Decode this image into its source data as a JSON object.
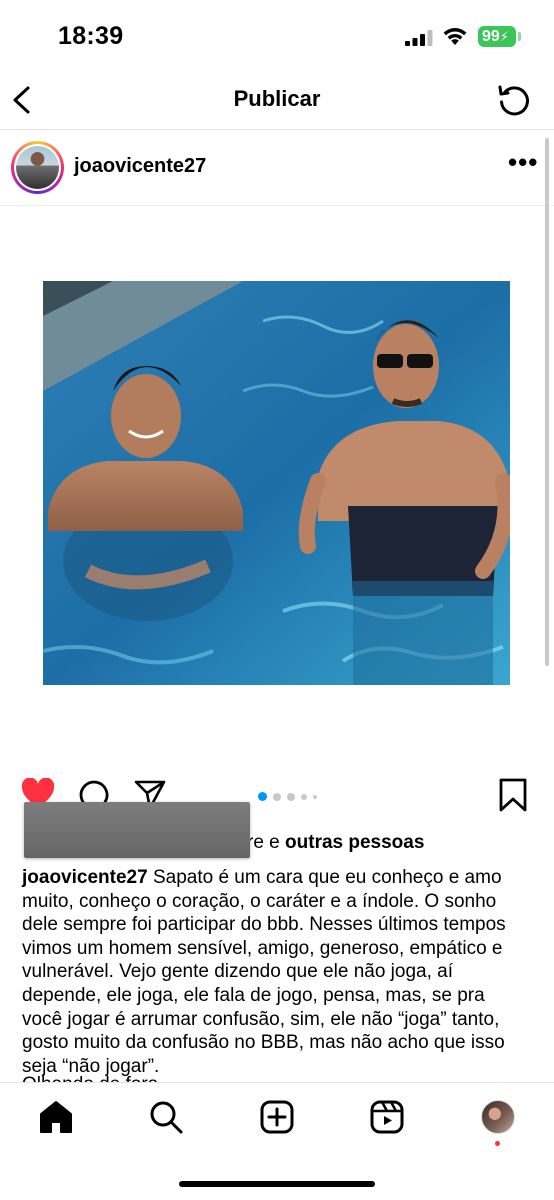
{
  "status_bar": {
    "time": "18:39",
    "battery": "99",
    "icons": [
      "cellular-signal-icon",
      "wifi-icon",
      "battery-charging-icon"
    ],
    "battery_color": "#3cc65a"
  },
  "header": {
    "title": "Publicar",
    "back_icon": "chevron-left-icon",
    "refresh_icon": "refresh-icon"
  },
  "post": {
    "username": "joaovicente27",
    "more_icon": "more-horizontal-icon",
    "photo_description_icon": "post-image",
    "carousel": {
      "total": 5,
      "current": 1,
      "active_color": "#0095f6"
    },
    "liked": true,
    "like_color": "#ff3040",
    "likes": {
      "visible_fragment": "re e ",
      "others_bold": "outras pessoas"
    },
    "caption": {
      "author": "joaovicente27",
      "text": "Sapato é um cara que eu conheço e amo muito, conheço o coração, o caráter e a índole. O sonho dele sempre foi participar do bbb. Nesses últimos tempos vimos um homem sensível, amigo, generoso, empático e vulnerável. Vejo gente dizendo que ele não joga, aí depende, ele joga, ele fala de jogo, pensa, mas, se pra você jogar é arrumar confusão, sim, ele não “joga” tanto, gosto muito da confusão no BBB, mas não acho que isso seja “não jogar”.",
      "cut_line": "Olhando de fora..."
    }
  },
  "tab_bar": {
    "items": [
      "home-icon",
      "search-icon",
      "create-icon",
      "reels-icon",
      "profile-avatar"
    ],
    "notification_color": "#ff3040"
  }
}
